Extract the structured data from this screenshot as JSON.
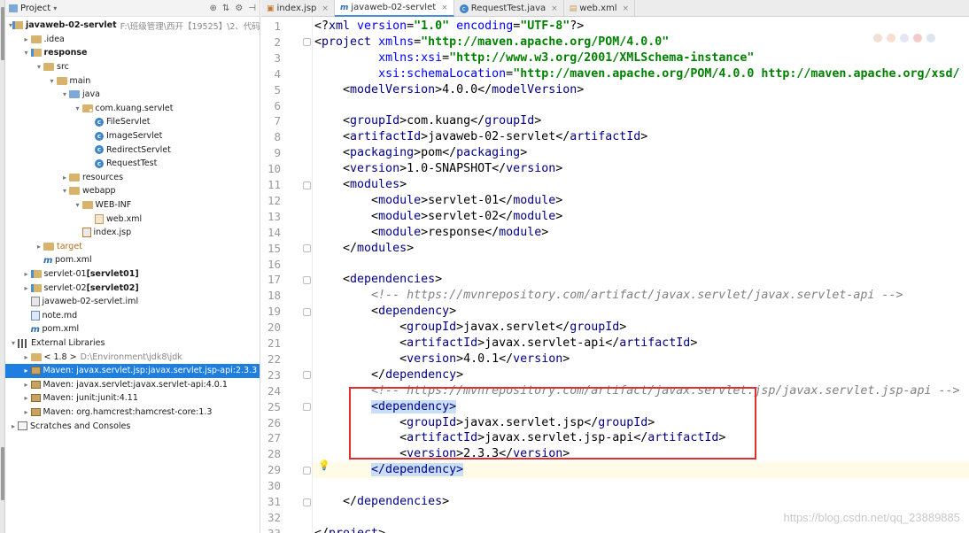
{
  "panel": {
    "title": "Project",
    "tree": [
      {
        "indent": 0,
        "arrow": "▾",
        "icon": "module",
        "label": "javaweb-02-servlet",
        "bold": true,
        "path": "F:\\班级管理\\西开【19525】\\2、代码\\Java"
      },
      {
        "indent": 1,
        "arrow": "▸",
        "icon": "folder",
        "label": ".idea"
      },
      {
        "indent": 1,
        "arrow": "▾",
        "icon": "module",
        "label": "response",
        "bold": true
      },
      {
        "indent": 2,
        "arrow": "▾",
        "icon": "folder",
        "label": "src"
      },
      {
        "indent": 3,
        "arrow": "▾",
        "icon": "folder",
        "label": "main"
      },
      {
        "indent": 4,
        "arrow": "▾",
        "icon": "src",
        "label": "java"
      },
      {
        "indent": 5,
        "arrow": "▾",
        "icon": "pkg",
        "label": "com.kuang.servlet"
      },
      {
        "indent": 6,
        "arrow": "",
        "icon": "class",
        "label": "FileServlet"
      },
      {
        "indent": 6,
        "arrow": "",
        "icon": "class",
        "label": "ImageServlet"
      },
      {
        "indent": 6,
        "arrow": "",
        "icon": "class",
        "label": "RedirectServlet"
      },
      {
        "indent": 6,
        "arrow": "",
        "icon": "class",
        "label": "RequestTest"
      },
      {
        "indent": 4,
        "arrow": "▸",
        "icon": "folder",
        "label": "resources"
      },
      {
        "indent": 4,
        "arrow": "▾",
        "icon": "folder",
        "label": "webapp"
      },
      {
        "indent": 5,
        "arrow": "▾",
        "icon": "folder",
        "label": "WEB-INF"
      },
      {
        "indent": 6,
        "arrow": "",
        "icon": "xml",
        "label": "web.xml"
      },
      {
        "indent": 5,
        "arrow": "",
        "icon": "jsp",
        "label": "index.jsp"
      },
      {
        "indent": 2,
        "arrow": "▸",
        "icon": "folder",
        "label": "target",
        "orange": true
      },
      {
        "indent": 2,
        "arrow": "",
        "icon": "maven",
        "label": "pom.xml"
      },
      {
        "indent": 1,
        "arrow": "▸",
        "icon": "module",
        "label": "servlet-01 ",
        "boldSuffix": "[servlet01]"
      },
      {
        "indent": 1,
        "arrow": "▸",
        "icon": "module",
        "label": "servlet-02 ",
        "boldSuffix": "[servlet02]"
      },
      {
        "indent": 1,
        "arrow": "",
        "icon": "iml",
        "label": "javaweb-02-servlet.iml"
      },
      {
        "indent": 1,
        "arrow": "",
        "icon": "md",
        "label": "note.md"
      },
      {
        "indent": 1,
        "arrow": "",
        "icon": "maven",
        "label": "pom.xml"
      },
      {
        "indent": 0,
        "arrow": "▾",
        "icon": "lib",
        "label": "External Libraries"
      },
      {
        "indent": 1,
        "arrow": "▸",
        "icon": "folder",
        "label": "< 1.8 >",
        "path": "D:\\Environment\\jdk8\\jdk"
      },
      {
        "indent": 1,
        "arrow": "▸",
        "icon": "jar",
        "label": "Maven: javax.servlet.jsp:javax.servlet.jsp-api:2.3.3",
        "selected": true
      },
      {
        "indent": 1,
        "arrow": "▸",
        "icon": "jar",
        "label": "Maven: javax.servlet:javax.servlet-api:4.0.1"
      },
      {
        "indent": 1,
        "arrow": "▸",
        "icon": "jar",
        "label": "Maven: junit:junit:4.11"
      },
      {
        "indent": 1,
        "arrow": "▸",
        "icon": "jar",
        "label": "Maven: org.hamcrest:hamcrest-core:1.3"
      },
      {
        "indent": 0,
        "arrow": "▸",
        "icon": "scratch",
        "label": "Scratches and Consoles"
      }
    ]
  },
  "tabs": [
    {
      "icon": "jsp",
      "label": "index.jsp",
      "active": false
    },
    {
      "icon": "mvn",
      "label": "javaweb-02-servlet",
      "active": true
    },
    {
      "icon": "cls",
      "label": "RequestTest.java",
      "active": false
    },
    {
      "icon": "xml",
      "label": "web.xml",
      "active": false
    }
  ],
  "code": [
    [
      [
        "tx",
        "<?"
      ],
      [
        "tg",
        "xml "
      ],
      [
        "an",
        "version"
      ],
      [
        "tx",
        "="
      ],
      [
        "av",
        "\"1.0\" "
      ],
      [
        "an",
        "encoding"
      ],
      [
        "tx",
        "="
      ],
      [
        "av",
        "\"UTF-8\""
      ],
      [
        "tx",
        "?>"
      ]
    ],
    [
      [
        "tx",
        "<"
      ],
      [
        "tg",
        "project "
      ],
      [
        "an",
        "xmlns"
      ],
      [
        "tx",
        "="
      ],
      [
        "av",
        "\"http://maven.apache.org/POM/4.0.0\""
      ]
    ],
    [
      [
        "tx",
        "         "
      ],
      [
        "an",
        "xmlns:xsi"
      ],
      [
        "tx",
        "="
      ],
      [
        "av",
        "\"http://www.w3.org/2001/XMLSchema-instance\""
      ]
    ],
    [
      [
        "tx",
        "         "
      ],
      [
        "an",
        "xsi:schemaLocation"
      ],
      [
        "tx",
        "="
      ],
      [
        "av",
        "\"http://maven.apache.org/POM/4.0.0 http://maven.apache.org/xsd/"
      ]
    ],
    [
      [
        "tx",
        "    <"
      ],
      [
        "tg",
        "modelVersion"
      ],
      [
        "tx",
        ">4.0.0</"
      ],
      [
        "tg",
        "modelVersion"
      ],
      [
        "tx",
        ">"
      ]
    ],
    [
      [
        "tx",
        ""
      ]
    ],
    [
      [
        "tx",
        "    <"
      ],
      [
        "tg",
        "groupId"
      ],
      [
        "tx",
        ">com.kuang</"
      ],
      [
        "tg",
        "groupId"
      ],
      [
        "tx",
        ">"
      ]
    ],
    [
      [
        "tx",
        "    <"
      ],
      [
        "tg",
        "artifactId"
      ],
      [
        "tx",
        ">javaweb-02-servlet</"
      ],
      [
        "tg",
        "artifactId"
      ],
      [
        "tx",
        ">"
      ]
    ],
    [
      [
        "tx",
        "    <"
      ],
      [
        "tg",
        "packaging"
      ],
      [
        "tx",
        ">pom</"
      ],
      [
        "tg",
        "packaging"
      ],
      [
        "tx",
        ">"
      ]
    ],
    [
      [
        "tx",
        "    <"
      ],
      [
        "tg",
        "version"
      ],
      [
        "tx",
        ">1.0-SNAPSHOT</"
      ],
      [
        "tg",
        "version"
      ],
      [
        "tx",
        ">"
      ]
    ],
    [
      [
        "tx",
        "    <"
      ],
      [
        "tg",
        "modules"
      ],
      [
        "tx",
        ">"
      ]
    ],
    [
      [
        "tx",
        "        <"
      ],
      [
        "tg",
        "module"
      ],
      [
        "tx",
        ">servlet-01</"
      ],
      [
        "tg",
        "module"
      ],
      [
        "tx",
        ">"
      ]
    ],
    [
      [
        "tx",
        "        <"
      ],
      [
        "tg",
        "module"
      ],
      [
        "tx",
        ">servlet-02</"
      ],
      [
        "tg",
        "module"
      ],
      [
        "tx",
        ">"
      ]
    ],
    [
      [
        "tx",
        "        <"
      ],
      [
        "tg",
        "module"
      ],
      [
        "tx",
        ">response</"
      ],
      [
        "tg",
        "module"
      ],
      [
        "tx",
        ">"
      ]
    ],
    [
      [
        "tx",
        "    </"
      ],
      [
        "tg",
        "modules"
      ],
      [
        "tx",
        ">"
      ]
    ],
    [
      [
        "tx",
        ""
      ]
    ],
    [
      [
        "tx",
        "    <"
      ],
      [
        "tg",
        "dependencies"
      ],
      [
        "tx",
        ">"
      ]
    ],
    [
      [
        "tx",
        "        "
      ],
      [
        "cm",
        "<!-- https://mvnrepository.com/artifact/javax.servlet/javax.servlet-api -->"
      ]
    ],
    [
      [
        "tx",
        "        <"
      ],
      [
        "tg",
        "dependency"
      ],
      [
        "tx",
        ">"
      ]
    ],
    [
      [
        "tx",
        "            <"
      ],
      [
        "tg",
        "groupId"
      ],
      [
        "tx",
        ">javax.servlet</"
      ],
      [
        "tg",
        "groupId"
      ],
      [
        "tx",
        ">"
      ]
    ],
    [
      [
        "tx",
        "            <"
      ],
      [
        "tg",
        "artifactId"
      ],
      [
        "tx",
        ">javax.servlet-api</"
      ],
      [
        "tg",
        "artifactId"
      ],
      [
        "tx",
        ">"
      ]
    ],
    [
      [
        "tx",
        "            <"
      ],
      [
        "tg",
        "version"
      ],
      [
        "tx",
        ">4.0.1</"
      ],
      [
        "tg",
        "version"
      ],
      [
        "tx",
        ">"
      ]
    ],
    [
      [
        "tx",
        "        </"
      ],
      [
        "tg",
        "dependency"
      ],
      [
        "tx",
        ">"
      ]
    ],
    [
      [
        "tx",
        "        "
      ],
      [
        "cm",
        "<!-- https://mvnrepository.com/artifact/javax.servlet.jsp/javax.servlet.jsp-api -->"
      ]
    ],
    [
      [
        "tx",
        "        "
      ],
      [
        "tghl",
        "<dependency>"
      ]
    ],
    [
      [
        "tx",
        "            <"
      ],
      [
        "tg",
        "groupId"
      ],
      [
        "tx",
        ">javax.servlet.jsp</"
      ],
      [
        "tg",
        "groupId"
      ],
      [
        "tx",
        ">"
      ]
    ],
    [
      [
        "tx",
        "            <"
      ],
      [
        "tg",
        "artifactId"
      ],
      [
        "tx",
        ">javax.servlet.jsp-api</"
      ],
      [
        "tg",
        "artifactId"
      ],
      [
        "tx",
        ">"
      ]
    ],
    [
      [
        "tx",
        "            <"
      ],
      [
        "tg",
        "version"
      ],
      [
        "tx",
        ">2.3.3</"
      ],
      [
        "tg",
        "version"
      ],
      [
        "tx",
        ">"
      ]
    ],
    [
      [
        "tx",
        "        "
      ],
      [
        "tghl",
        "</dependency>"
      ]
    ],
    [
      [
        "tx",
        ""
      ]
    ],
    [
      [
        "tx",
        "    </"
      ],
      [
        "tg",
        "dependencies"
      ],
      [
        "tx",
        ">"
      ]
    ],
    [
      [
        "tx",
        ""
      ]
    ],
    [
      [
        "tx",
        "</"
      ],
      [
        "tg",
        "project"
      ],
      [
        "tx",
        ">"
      ]
    ]
  ],
  "fold_lines": [
    2,
    11,
    15,
    17,
    19,
    23,
    25,
    29,
    31
  ],
  "current_line": 29,
  "watermark": "https://blog.csdn.net/qq_23889885",
  "colors": {
    "highlight_box": "#e0312f",
    "selection": "#1f7fe0"
  }
}
